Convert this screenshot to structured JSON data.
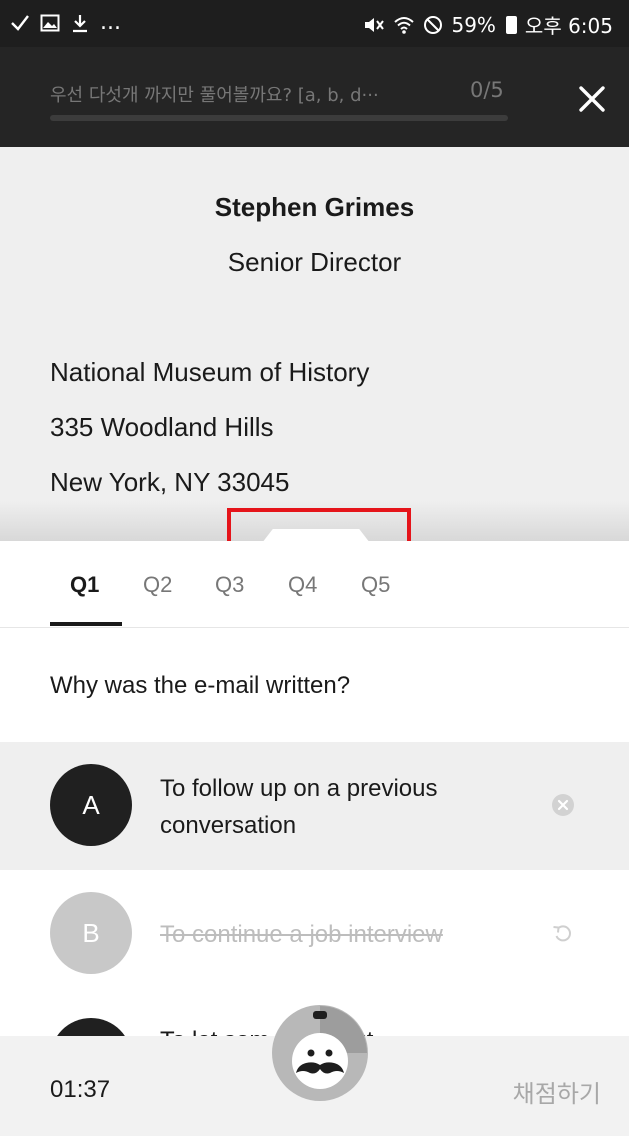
{
  "status_bar": {
    "left_icons": [
      "check-icon",
      "image-icon",
      "download-icon",
      "more-icon"
    ],
    "ellipsis": "...",
    "right_icons": [
      "mute-icon",
      "wifi-icon",
      "blocked-icon"
    ],
    "battery": "59%",
    "time": "오후 6:05"
  },
  "header": {
    "progress_label": "우선 다섯개 까지만 풀어볼까요? [a, b, d···",
    "progress_count": "0/5",
    "progress_fraction": 0,
    "close_icon": "close-icon"
  },
  "passage": {
    "name": "Stephen Grimes",
    "title": "Senior Director",
    "address_lines": [
      "National Museum of History",
      "335 Woodland Hills",
      "New York, NY 33045"
    ]
  },
  "tabs": [
    {
      "label": "Q1",
      "active": true
    },
    {
      "label": "Q2",
      "active": false
    },
    {
      "label": "Q3",
      "active": false
    },
    {
      "label": "Q4",
      "active": false
    },
    {
      "label": "Q5",
      "active": false
    }
  ],
  "question": "Why was the e-mail written?",
  "options": [
    {
      "letter": "A",
      "text": "To follow up on a previous conversation",
      "state": "selected",
      "icon": "remove-circle-icon"
    },
    {
      "letter": "B",
      "text": "To continue a job interview",
      "state": "eliminated",
      "icon": "undo-icon"
    },
    {
      "letter": "",
      "text": "To let som         ow about",
      "state": "normal"
    }
  ],
  "footer": {
    "timer": "01:37",
    "grade_button": "채점하기",
    "mascot_icon": "mustache-mascot-icon"
  },
  "colors": {
    "dark_bar": "#252525",
    "status_bar": "#1e1e1e",
    "passage_bg": "#efefef",
    "selected_option_bg": "#efefef",
    "highlight": "#e5141a"
  }
}
